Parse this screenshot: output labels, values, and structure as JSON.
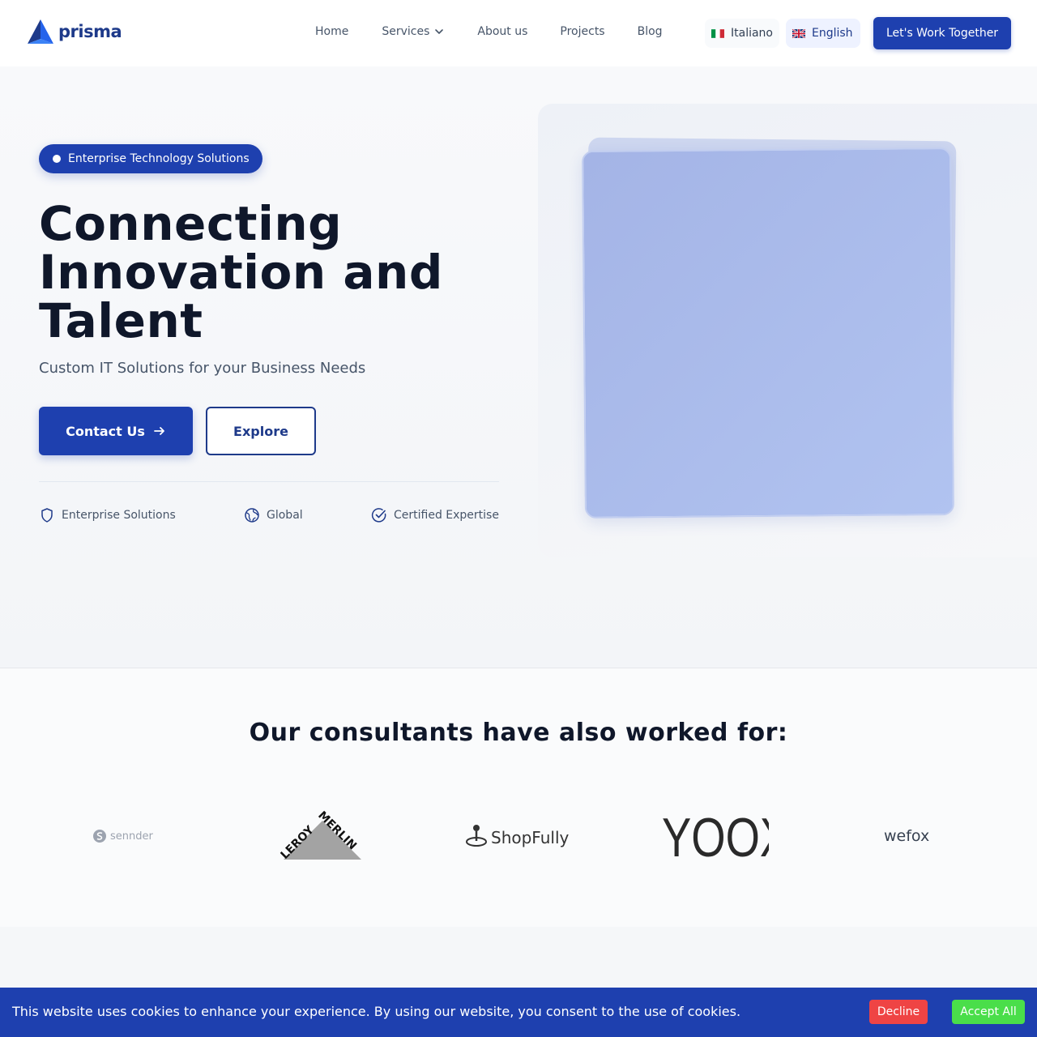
{
  "header": {
    "logo_text": "prisma",
    "nav": [
      {
        "label": "Home"
      },
      {
        "label": "Services"
      },
      {
        "label": "About us"
      },
      {
        "label": "Projects"
      },
      {
        "label": "Blog"
      }
    ],
    "lang_it": "Italiano",
    "lang_en": "English",
    "cta": "Let's Work Together"
  },
  "hero": {
    "badge": "Enterprise Technology Solutions",
    "headline_1": "Connecting",
    "headline_2": "Innovation and",
    "headline_3": "Talent",
    "subheadline": "Custom IT Solutions for your Business Needs",
    "contact_button": "Contact Us",
    "explore_button": "Explore",
    "features": [
      {
        "label": "Enterprise Solutions",
        "icon": "shield-icon"
      },
      {
        "label": "Global",
        "icon": "globe-icon"
      },
      {
        "label": "Certified Expertise",
        "icon": "check-circle-icon"
      }
    ]
  },
  "clients": {
    "title": "Our consultants have also worked for:",
    "logos": [
      {
        "name": "sennder"
      },
      {
        "name": "LEROY MERLIN"
      },
      {
        "name": "ShopFully"
      },
      {
        "name": "YOOX"
      },
      {
        "name": "wefox"
      }
    ]
  },
  "cookie": {
    "text": "This website uses cookies to enhance your experience. By using our website, you consent to the use of cookies.",
    "decline": "Decline",
    "accept": "Accept All"
  },
  "colors": {
    "primary": "#1e40af",
    "decline": "#ef4444",
    "accept": "#4ade4a"
  }
}
